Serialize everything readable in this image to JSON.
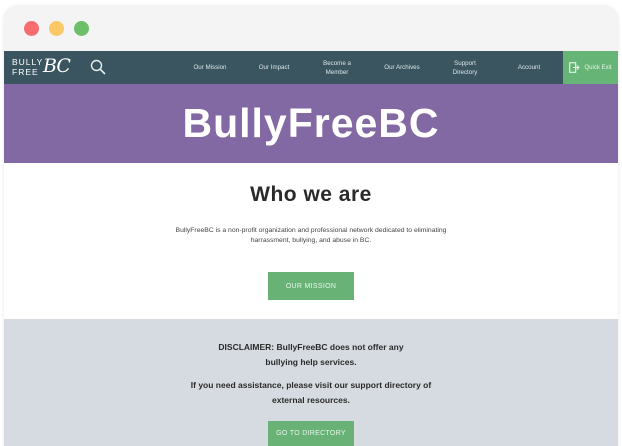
{
  "window": {
    "controls": [
      "close",
      "minimize",
      "maximize"
    ]
  },
  "nav": {
    "logo": {
      "line1": "BULLY",
      "line2": "FREE",
      "script": "BC"
    },
    "items": [
      {
        "label": "Our Mission"
      },
      {
        "label": "Our Impact"
      },
      {
        "label": "Become a Member"
      },
      {
        "label": "Our Archives"
      },
      {
        "label": "Support Directory"
      },
      {
        "label": "Account"
      }
    ],
    "quick_exit": "Quick Exit"
  },
  "hero": {
    "title": "BullyFreeBC"
  },
  "who": {
    "heading": "Who we are",
    "description": "BullyFreeBC is a non-profit organization and professional network dedicated to eliminating harrassment, bullying, and abuse in BC.",
    "button": "OUR MISSION"
  },
  "disclaimer": {
    "line1": "DISCLAIMER: BullyFreeBC does not offer any bullying help services.",
    "line2": "If you need assistance, please visit our support directory of external resources.",
    "button": "GO TO DIRECTORY"
  },
  "colors": {
    "nav_bg": "#3a5560",
    "hero_bg": "#8269a3",
    "accent_green": "#68b276",
    "disclaimer_bg": "#d5dbe0"
  }
}
